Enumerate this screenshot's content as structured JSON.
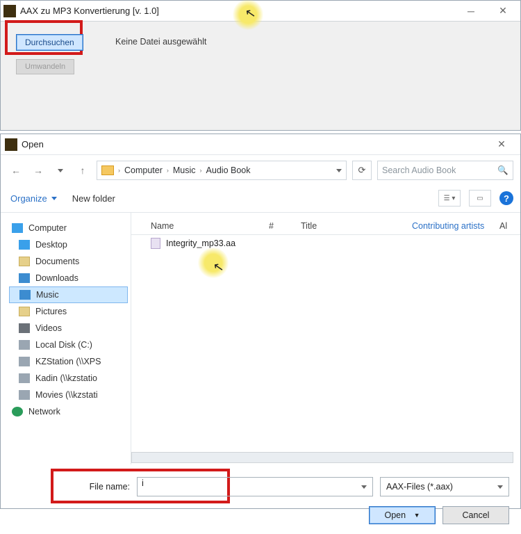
{
  "win1": {
    "title": "AAX zu MP3 Konvertierung [v. 1.0]",
    "browse_label": "Durchsuchen",
    "status": "Keine Datei ausgewählt",
    "convert_label": "Umwandeln"
  },
  "dialog": {
    "title": "Open",
    "breadcrumb": [
      "Computer",
      "Music",
      "Audio Book"
    ],
    "search_placeholder": "Search Audio Book",
    "toolbar": {
      "organize": "Organize",
      "new_folder": "New folder"
    },
    "sidebar": [
      {
        "icon": "ico-computer",
        "label": "Computer",
        "root": true
      },
      {
        "icon": "ico-desktop",
        "label": "Desktop"
      },
      {
        "icon": "ico-folder",
        "label": "Documents"
      },
      {
        "icon": "ico-down",
        "label": "Downloads"
      },
      {
        "icon": "ico-music",
        "label": "Music",
        "selected": true
      },
      {
        "icon": "ico-folder",
        "label": "Pictures"
      },
      {
        "icon": "ico-video",
        "label": "Videos"
      },
      {
        "icon": "ico-disk",
        "label": "Local Disk (C:)"
      },
      {
        "icon": "ico-disk",
        "label": "KZStation (\\\\XPS"
      },
      {
        "icon": "ico-disk",
        "label": "Kadin (\\\\kzstatio"
      },
      {
        "icon": "ico-disk",
        "label": "Movies (\\\\kzstati"
      },
      {
        "icon": "ico-net",
        "label": "Network",
        "root": true
      }
    ],
    "columns": {
      "name": "Name",
      "num": "#",
      "title": "Title",
      "artists": "Contributing artists",
      "album": "Al"
    },
    "files": [
      {
        "name": "Integrity_mp33.aa"
      }
    ],
    "file_name_label": "File name:",
    "file_name_value": "i",
    "file_type": "AAX-Files (*.aax)",
    "open_btn": "Open",
    "cancel_btn": "Cancel"
  }
}
